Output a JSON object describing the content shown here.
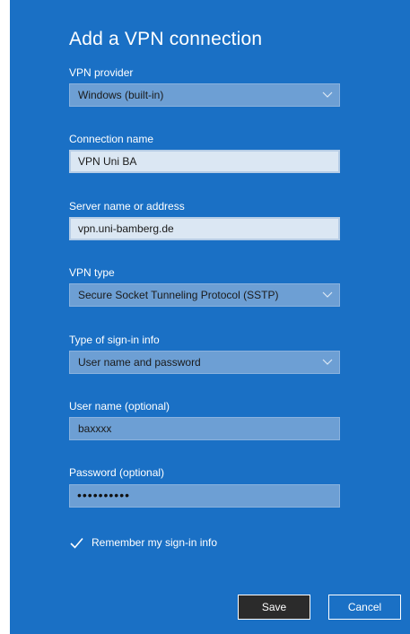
{
  "dialog": {
    "title": "Add a VPN connection",
    "accent_color": "#1a70c5"
  },
  "fields": {
    "vpn_provider": {
      "label": "VPN provider",
      "value": "Windows (built-in)"
    },
    "connection_name": {
      "label": "Connection name",
      "value": "VPN Uni BA"
    },
    "server": {
      "label": "Server name or address",
      "value": "vpn.uni-bamberg.de"
    },
    "vpn_type": {
      "label": "VPN type",
      "value": "Secure Socket Tunneling Protocol (SSTP)"
    },
    "signin_type": {
      "label": "Type of sign-in info",
      "value": "User name and password"
    },
    "username": {
      "label": "User name (optional)",
      "value": "baxxxx"
    },
    "password": {
      "label": "Password (optional)",
      "value": "••••••••••"
    }
  },
  "remember": {
    "label": "Remember my sign-in info",
    "checked": true
  },
  "buttons": {
    "save": "Save",
    "cancel": "Cancel"
  },
  "icons": {
    "dropdown": "chevron-down-icon",
    "checkbox": "checkmark-icon"
  }
}
